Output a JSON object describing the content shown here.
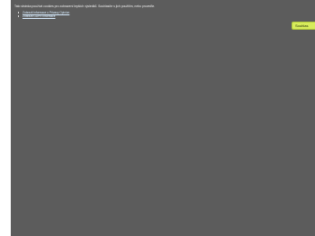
{
  "cookie_notice": {
    "text": "Tato stránka používá cookies pro zobrazení lepších výsledků. Souhlasíte s jich použitím, nebo proveďte.",
    "links": [
      {
        "label": "Zobrazit informace o Privacy Opinion"
      },
      {
        "label": "Zobrazit GDPR informace"
      }
    ],
    "accept_label": "Souhlas"
  },
  "colors": {
    "overlay": "#5c5c5c",
    "accept_button": "#d7ec5b",
    "link": "#d7ecff"
  }
}
